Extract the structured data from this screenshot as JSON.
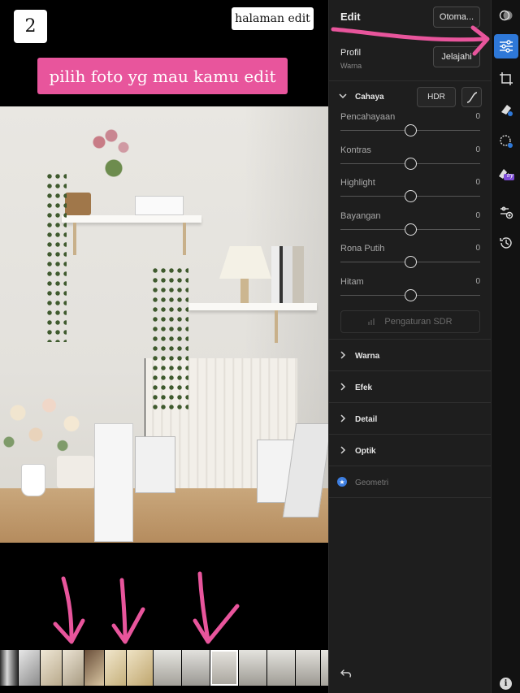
{
  "overlay": {
    "step_number": "2",
    "title_badge": "halaman edit",
    "caption": "pilih foto yg mau kamu edit",
    "annotation_color": "#e8559c"
  },
  "header": {
    "title": "Edit",
    "auto_label": "Otoma...",
    "profile_label": "Profil",
    "profile_value": "Warna",
    "browse_label": "Jelajahi"
  },
  "light": {
    "label": "Cahaya",
    "hdr_label": "HDR",
    "sdr_label": "Pengaturan SDR",
    "sliders": [
      {
        "name": "Pencahayaan",
        "value": "0",
        "fraction": 0.5
      },
      {
        "name": "Kontras",
        "value": "0",
        "fraction": 0.5
      },
      {
        "name": "Highlight",
        "value": "0",
        "fraction": 0.5
      },
      {
        "name": "Bayangan",
        "value": "0",
        "fraction": 0.5
      },
      {
        "name": "Rona Putih",
        "value": "0",
        "fraction": 0.5
      },
      {
        "name": "Hitam",
        "value": "0",
        "fraction": 0.5
      }
    ]
  },
  "sections": [
    {
      "label": "Warna"
    },
    {
      "label": "Efek"
    },
    {
      "label": "Detail"
    },
    {
      "label": "Optik"
    },
    {
      "label": "Geometri"
    }
  ],
  "toolbar": {
    "try_badge": "try",
    "info_glyph": "i"
  },
  "accent_color": "#2e78d8"
}
